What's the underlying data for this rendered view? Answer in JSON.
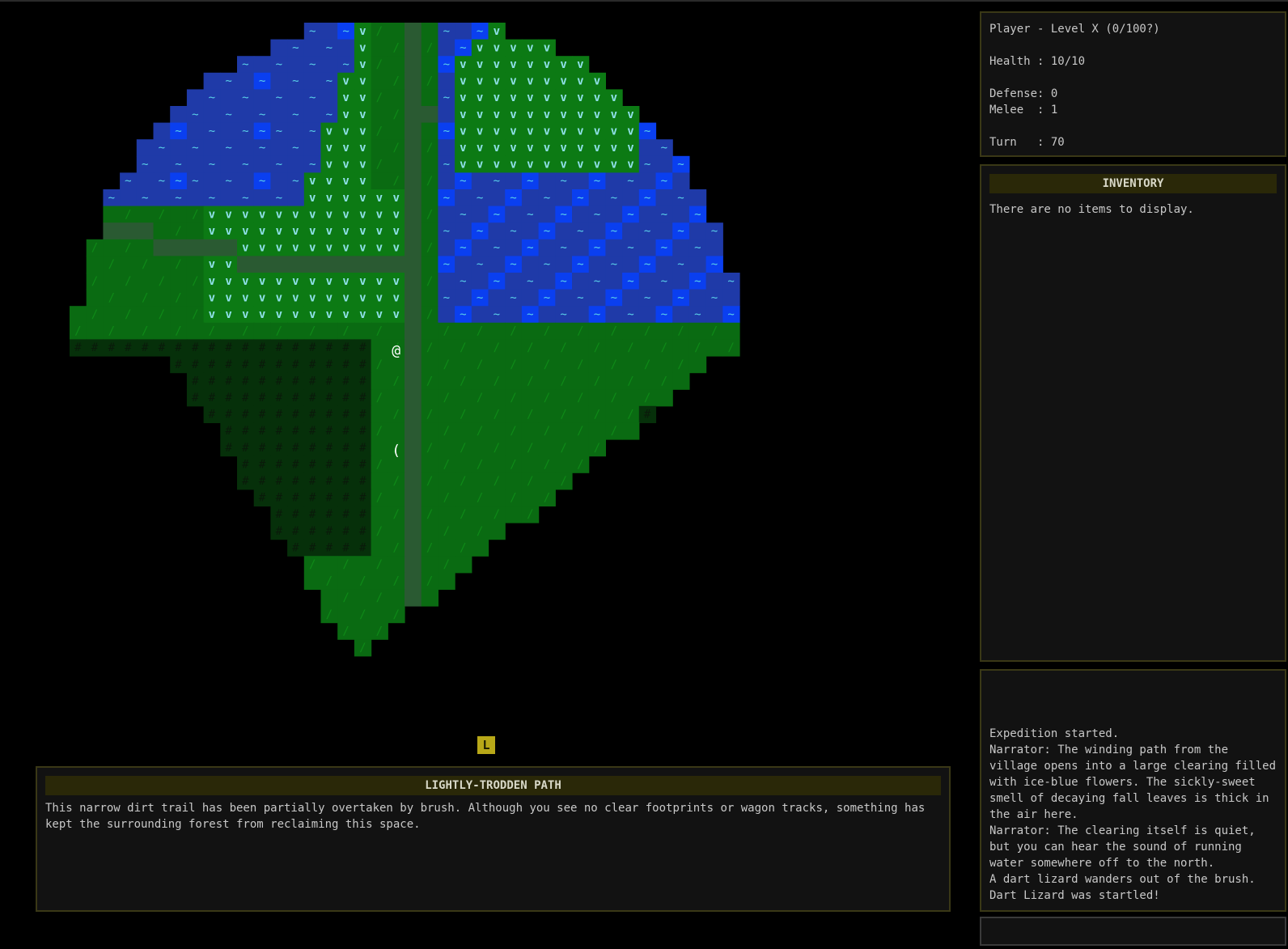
{
  "stats": {
    "title": "Player - Level X (0/100?)",
    "health": "Health : 10/10",
    "defense": "Defense: 0",
    "melee": "Melee  : 1",
    "turn": "Turn   : 70"
  },
  "inventory": {
    "title": "INVENTORY",
    "empty_text": "There are no items to display."
  },
  "log": {
    "entries": [
      "Expedition started.",
      "Narrator: The winding path from the village opens into a large clearing filled with ice-blue flowers. The sickly-sweet smell of decaying fall leaves is thick in the air here.",
      "Narrator: The clearing itself is quiet, but you can hear the sound of running water somewhere off to the north.",
      "A dart lizard wanders out of the brush.",
      "Dart Lizard was startled!"
    ]
  },
  "location": {
    "marker": "L",
    "title": "LIGHTLY-TRODDEN PATH",
    "description": "This narrow dirt trail has been partially overtaken by brush. Although you see no clear footprints or wagon tracks, something has kept the surrounding forest from reclaiming this space."
  },
  "map": {
    "player_glyph": "@",
    "item_glyph": "(",
    "legend": {
      "deep_water": "~",
      "shallow_water": "~",
      "flowers": "v",
      "grass": "/",
      "trees": "#",
      "path": "."
    },
    "colors": {
      "deep_water": "#1f3aa8",
      "shallow_water": "#0a3ff0",
      "water_glyph": "#5ad0e8",
      "grass": "#0a6b12",
      "grass_bright": "#0c7a14",
      "flower_glyph": "#8fe0e8",
      "trees": "#06300a",
      "tree_glyph": "#0a1a0a",
      "path": "#2a5a32",
      "player": "#ffffff"
    }
  }
}
